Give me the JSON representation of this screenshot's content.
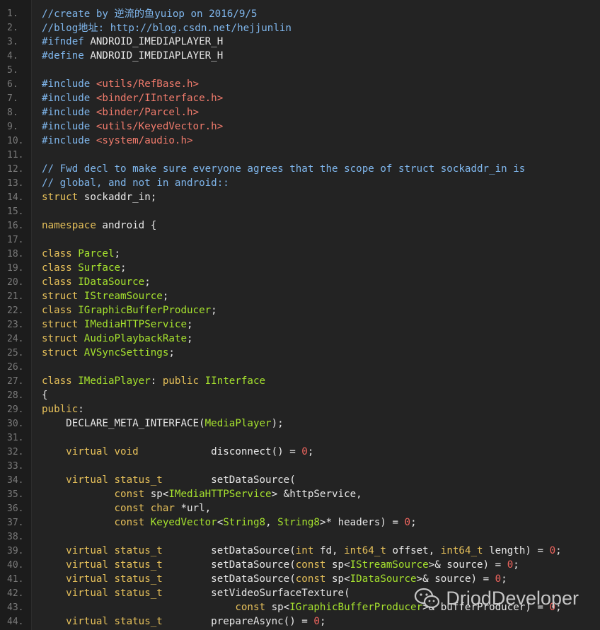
{
  "watermark": {
    "text": "DriodDeveloper",
    "icon": "wechat-icon"
  },
  "colors": {
    "background": "#232323",
    "comment": "#7fb6ec",
    "keyword": "#e6c05a",
    "type": "#a6e22e",
    "string": "#f07b6c",
    "number": "#f0655e",
    "text": "#e8e8e8",
    "line_number": "#7a7a7a"
  },
  "lines": [
    {
      "n": "1.",
      "tokens": [
        [
          "c",
          "//create by 逆流的鱼yuiop on 2016/9/5"
        ]
      ]
    },
    {
      "n": "2.",
      "tokens": [
        [
          "c",
          "//blog地址: http://blog.csdn.net/hejjunlin"
        ]
      ]
    },
    {
      "n": "3.",
      "tokens": [
        [
          "c",
          "#ifndef "
        ],
        [
          "d",
          "ANDROID_IMEDIAPLAYER_H"
        ]
      ]
    },
    {
      "n": "4.",
      "tokens": [
        [
          "c",
          "#define "
        ],
        [
          "d",
          "ANDROID_IMEDIAPLAYER_H"
        ]
      ]
    },
    {
      "n": "5.",
      "tokens": []
    },
    {
      "n": "6.",
      "tokens": [
        [
          "c",
          "#include "
        ],
        [
          "s",
          "<utils/RefBase.h>"
        ]
      ]
    },
    {
      "n": "7.",
      "tokens": [
        [
          "c",
          "#include "
        ],
        [
          "s",
          "<binder/IInterface.h>"
        ]
      ]
    },
    {
      "n": "8.",
      "tokens": [
        [
          "c",
          "#include "
        ],
        [
          "s",
          "<binder/Parcel.h>"
        ]
      ]
    },
    {
      "n": "9.",
      "tokens": [
        [
          "c",
          "#include "
        ],
        [
          "s",
          "<utils/KeyedVector.h>"
        ]
      ]
    },
    {
      "n": "10.",
      "tokens": [
        [
          "c",
          "#include "
        ],
        [
          "s",
          "<system/audio.h>"
        ]
      ]
    },
    {
      "n": "11.",
      "tokens": []
    },
    {
      "n": "12.",
      "tokens": [
        [
          "c",
          "// Fwd decl to make sure everyone agrees that the scope of struct sockaddr_in is"
        ]
      ]
    },
    {
      "n": "13.",
      "tokens": [
        [
          "c",
          "// global, and not in android::"
        ]
      ]
    },
    {
      "n": "14.",
      "tokens": [
        [
          "k",
          "struct "
        ],
        [
          "d",
          "sockaddr_in;"
        ]
      ]
    },
    {
      "n": "15.",
      "tokens": []
    },
    {
      "n": "16.",
      "tokens": [
        [
          "k",
          "namespace "
        ],
        [
          "d",
          "android {"
        ]
      ]
    },
    {
      "n": "17.",
      "tokens": []
    },
    {
      "n": "18.",
      "tokens": [
        [
          "k",
          "class "
        ],
        [
          "t",
          "Parcel"
        ],
        [
          "d",
          ";"
        ]
      ]
    },
    {
      "n": "19.",
      "tokens": [
        [
          "k",
          "class "
        ],
        [
          "t",
          "Surface"
        ],
        [
          "d",
          ";"
        ]
      ]
    },
    {
      "n": "20.",
      "tokens": [
        [
          "k",
          "class "
        ],
        [
          "t",
          "IDataSource"
        ],
        [
          "d",
          ";"
        ]
      ]
    },
    {
      "n": "21.",
      "tokens": [
        [
          "k",
          "struct "
        ],
        [
          "t",
          "IStreamSource"
        ],
        [
          "d",
          ";"
        ]
      ]
    },
    {
      "n": "22.",
      "tokens": [
        [
          "k",
          "class "
        ],
        [
          "t",
          "IGraphicBufferProducer"
        ],
        [
          "d",
          ";"
        ]
      ]
    },
    {
      "n": "23.",
      "tokens": [
        [
          "k",
          "struct "
        ],
        [
          "t",
          "IMediaHTTPService"
        ],
        [
          "d",
          ";"
        ]
      ]
    },
    {
      "n": "24.",
      "tokens": [
        [
          "k",
          "struct "
        ],
        [
          "t",
          "AudioPlaybackRate"
        ],
        [
          "d",
          ";"
        ]
      ]
    },
    {
      "n": "25.",
      "tokens": [
        [
          "k",
          "struct "
        ],
        [
          "t",
          "AVSyncSettings"
        ],
        [
          "d",
          ";"
        ]
      ]
    },
    {
      "n": "26.",
      "tokens": []
    },
    {
      "n": "27.",
      "tokens": [
        [
          "k",
          "class "
        ],
        [
          "t",
          "IMediaPlayer"
        ],
        [
          "d",
          ": "
        ],
        [
          "k",
          "public "
        ],
        [
          "t",
          "IInterface"
        ]
      ]
    },
    {
      "n": "28.",
      "tokens": [
        [
          "d",
          "{"
        ]
      ]
    },
    {
      "n": "29.",
      "tokens": [
        [
          "k",
          "public"
        ],
        [
          "d",
          ":"
        ]
      ]
    },
    {
      "n": "30.",
      "tokens": [
        [
          "d",
          "    DECLARE_META_INTERFACE("
        ],
        [
          "t",
          "MediaPlayer"
        ],
        [
          "d",
          ");"
        ]
      ]
    },
    {
      "n": "31.",
      "tokens": []
    },
    {
      "n": "32.",
      "tokens": [
        [
          "d",
          "    "
        ],
        [
          "k",
          "virtual void            "
        ],
        [
          "d",
          "disconnect() = "
        ],
        [
          "n",
          "0"
        ],
        [
          "d",
          ";"
        ]
      ]
    },
    {
      "n": "33.",
      "tokens": []
    },
    {
      "n": "34.",
      "tokens": [
        [
          "d",
          "    "
        ],
        [
          "k",
          "virtual status_t        "
        ],
        [
          "d",
          "setDataSource("
        ]
      ]
    },
    {
      "n": "35.",
      "tokens": [
        [
          "d",
          "            "
        ],
        [
          "k",
          "const "
        ],
        [
          "d",
          "sp<"
        ],
        [
          "t",
          "IMediaHTTPService"
        ],
        [
          "d",
          "> &httpService,"
        ]
      ]
    },
    {
      "n": "36.",
      "tokens": [
        [
          "d",
          "            "
        ],
        [
          "k",
          "const char "
        ],
        [
          "d",
          "*url,"
        ]
      ]
    },
    {
      "n": "37.",
      "tokens": [
        [
          "d",
          "            "
        ],
        [
          "k",
          "const "
        ],
        [
          "t",
          "KeyedVector"
        ],
        [
          "d",
          "<"
        ],
        [
          "t",
          "String8"
        ],
        [
          "d",
          ", "
        ],
        [
          "t",
          "String8"
        ],
        [
          "d",
          ">* headers) = "
        ],
        [
          "n",
          "0"
        ],
        [
          "d",
          ";"
        ]
      ]
    },
    {
      "n": "38.",
      "tokens": []
    },
    {
      "n": "39.",
      "tokens": [
        [
          "d",
          "    "
        ],
        [
          "k",
          "virtual status_t        "
        ],
        [
          "d",
          "setDataSource("
        ],
        [
          "k",
          "int "
        ],
        [
          "d",
          "fd, "
        ],
        [
          "k",
          "int64_t "
        ],
        [
          "d",
          "offset, "
        ],
        [
          "k",
          "int64_t "
        ],
        [
          "d",
          "length) = "
        ],
        [
          "n",
          "0"
        ],
        [
          "d",
          ";"
        ]
      ]
    },
    {
      "n": "40.",
      "tokens": [
        [
          "d",
          "    "
        ],
        [
          "k",
          "virtual status_t        "
        ],
        [
          "d",
          "setDataSource("
        ],
        [
          "k",
          "const "
        ],
        [
          "d",
          "sp<"
        ],
        [
          "t",
          "IStreamSource"
        ],
        [
          "d",
          ">& source) = "
        ],
        [
          "n",
          "0"
        ],
        [
          "d",
          ";"
        ]
      ]
    },
    {
      "n": "41.",
      "tokens": [
        [
          "d",
          "    "
        ],
        [
          "k",
          "virtual status_t        "
        ],
        [
          "d",
          "setDataSource("
        ],
        [
          "k",
          "const "
        ],
        [
          "d",
          "sp<"
        ],
        [
          "t",
          "IDataSource"
        ],
        [
          "d",
          ">& source) = "
        ],
        [
          "n",
          "0"
        ],
        [
          "d",
          ";"
        ]
      ]
    },
    {
      "n": "42.",
      "tokens": [
        [
          "d",
          "    "
        ],
        [
          "k",
          "virtual status_t        "
        ],
        [
          "d",
          "setVideoSurfaceTexture("
        ]
      ]
    },
    {
      "n": "43.",
      "tokens": [
        [
          "d",
          "                                "
        ],
        [
          "k",
          "const "
        ],
        [
          "d",
          "sp<"
        ],
        [
          "t",
          "IGraphicBufferProducer"
        ],
        [
          "d",
          ">& bufferProducer) = "
        ],
        [
          "n",
          "0"
        ],
        [
          "d",
          ";"
        ]
      ]
    },
    {
      "n": "44.",
      "tokens": [
        [
          "d",
          "    "
        ],
        [
          "k",
          "virtual status_t        "
        ],
        [
          "d",
          "prepareAsync() = "
        ],
        [
          "n",
          "0"
        ],
        [
          "d",
          ";"
        ]
      ]
    }
  ]
}
